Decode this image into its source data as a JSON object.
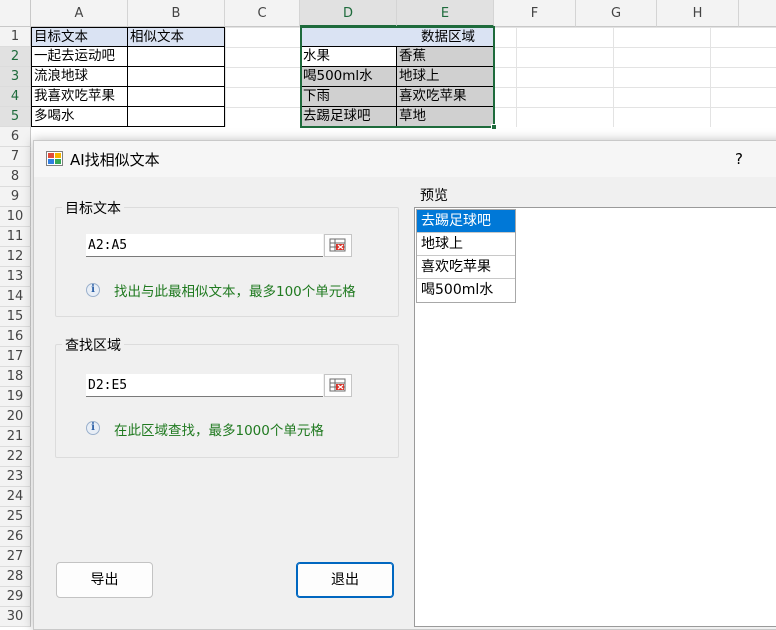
{
  "sheet": {
    "columns": [
      "A",
      "B",
      "C",
      "D",
      "E",
      "F",
      "G",
      "H"
    ],
    "rows": [
      "1",
      "2",
      "3",
      "4",
      "5",
      "6",
      "7",
      "8",
      "9",
      "10",
      "11",
      "12",
      "13",
      "14",
      "15",
      "16",
      "17",
      "18",
      "19",
      "20",
      "21",
      "22",
      "23",
      "24",
      "25",
      "26",
      "27",
      "28",
      "29",
      "30"
    ],
    "A1": "目标文本",
    "B1": "相似文本",
    "D1": "数据区域",
    "A2": "一起去运动吧",
    "A3": "流浪地球",
    "A4": "我喜欢吃苹果",
    "A5": "多喝水",
    "D2": "水果",
    "E2": "香蕉",
    "D3": "喝500ml水",
    "E3": "地球上",
    "D4": "下雨",
    "E4": "喜欢吃苹果",
    "D5": "去踢足球吧",
    "E5": "草地"
  },
  "dialog": {
    "title": "AI找相似文本",
    "help": "?",
    "target_group": {
      "label": "目标文本",
      "value": "A2:A5",
      "hint": "找出与此最相似文本，最多100个单元格"
    },
    "search_group": {
      "label": "查找区域",
      "value": "D2:E5",
      "hint": "在此区域查找，最多1000个单元格"
    },
    "preview": {
      "label": "预览",
      "items": [
        "去踢足球吧",
        "地球上",
        "喜欢吃苹果",
        "喝500ml水"
      ]
    },
    "export_label": "导出",
    "exit_label": "退出"
  },
  "colors": {
    "selection": "#1e6b3c",
    "header_fill": "#dae3f3",
    "data_fill": "#d0d0d0",
    "hint_text": "#207a20",
    "list_highlight": "#0078d7"
  }
}
